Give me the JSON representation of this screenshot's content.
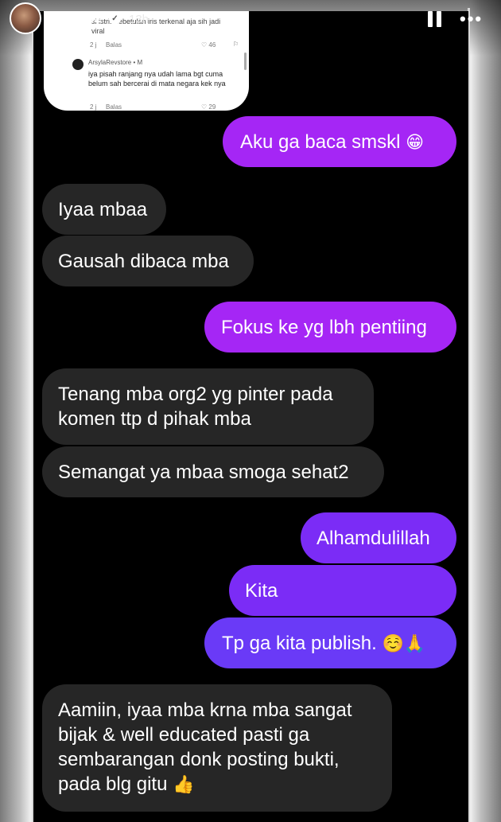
{
  "story": {
    "username": "ninik102",
    "verified_icon": "verified-badge-icon",
    "time": "13h",
    "controls": [
      "pause-icon",
      "more-icon"
    ]
  },
  "comment_card": {
    "cut_text_1": "si istri. Kebetulan iris terkenal aja sih jadi",
    "cut_text_2": "viral",
    "meta1": {
      "age": "2 j",
      "reply": "Balas",
      "likes": "46"
    },
    "user": "ArsylaRevstore",
    "user_badge": "M",
    "text": "iya pisah ranjang nya udah lama bgt cuma belum sah bercerai di mata negara kek nya",
    "meta2": {
      "age": "2 j",
      "reply": "Balas",
      "likes": "29"
    }
  },
  "messages": [
    {
      "side": "sent",
      "text": "Aku ga baca smskl",
      "emoji": "😁"
    },
    {
      "side": "received",
      "text": "Iyaa mbaa"
    },
    {
      "side": "received",
      "text": "Gausah dibaca mba"
    },
    {
      "side": "sent",
      "text": "Fokus ke yg lbh pentiing"
    },
    {
      "side": "received",
      "lines": [
        "Tenang mba org2 yg pinter pada",
        "komen ttp d pihak mba"
      ]
    },
    {
      "side": "received",
      "text": "Semangat ya mbaa smoga sehat2"
    },
    {
      "side": "sent",
      "text": "Alhamdulillah"
    },
    {
      "side": "sent",
      "text": "Kita"
    },
    {
      "side": "sent",
      "text": "Tp ga kita publish.",
      "emoji": "☺️🙏"
    },
    {
      "side": "received",
      "lines": [
        "Aamiin, iyaa mba krna mba sangat",
        "bijak & well educated pasti ga",
        "sembarangan donk posting bukti,",
        "pada blg gitu"
      ],
      "emoji": "👍"
    }
  ],
  "colors": {
    "sent_purple": "#a526f5",
    "sent_violet": "#7b2cf6",
    "received": "#262626",
    "screen": "#000000"
  }
}
